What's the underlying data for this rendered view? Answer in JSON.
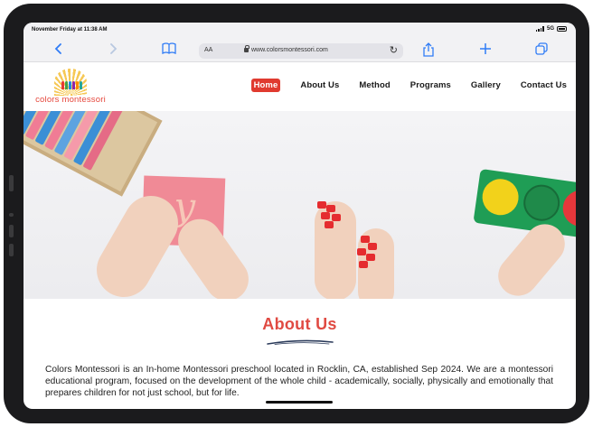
{
  "status_bar": {
    "time": "November Friday at 11:38 AM",
    "signal_label": "5G"
  },
  "browser": {
    "text_size_label": "AA",
    "url": "www.colorsmontessori.com"
  },
  "site": {
    "logo_text": "colors montessori",
    "nav": [
      {
        "label": "Home",
        "active": true
      },
      {
        "label": "About Us",
        "active": false
      },
      {
        "label": "Method",
        "active": false
      },
      {
        "label": "Programs",
        "active": false
      },
      {
        "label": "Gallery",
        "active": false
      },
      {
        "label": "Contact Us",
        "active": false
      }
    ],
    "accent_color": "#e03a2f"
  },
  "about": {
    "title": "About Us",
    "body": "Colors Montessori is an In-home Montessori preschool located in Rocklin, CA, established Sep 2024. We are a montessori educational program, focused on the development of the whole child - academically, socially, physically and emotionally that prepares children for not just school, but for life."
  },
  "icons": [
    "back-icon",
    "forward-icon",
    "bookmarks-icon",
    "lock-icon",
    "reload-icon",
    "share-icon",
    "new-tab-icon",
    "tabs-icon",
    "battery-icon",
    "signal-icon"
  ]
}
